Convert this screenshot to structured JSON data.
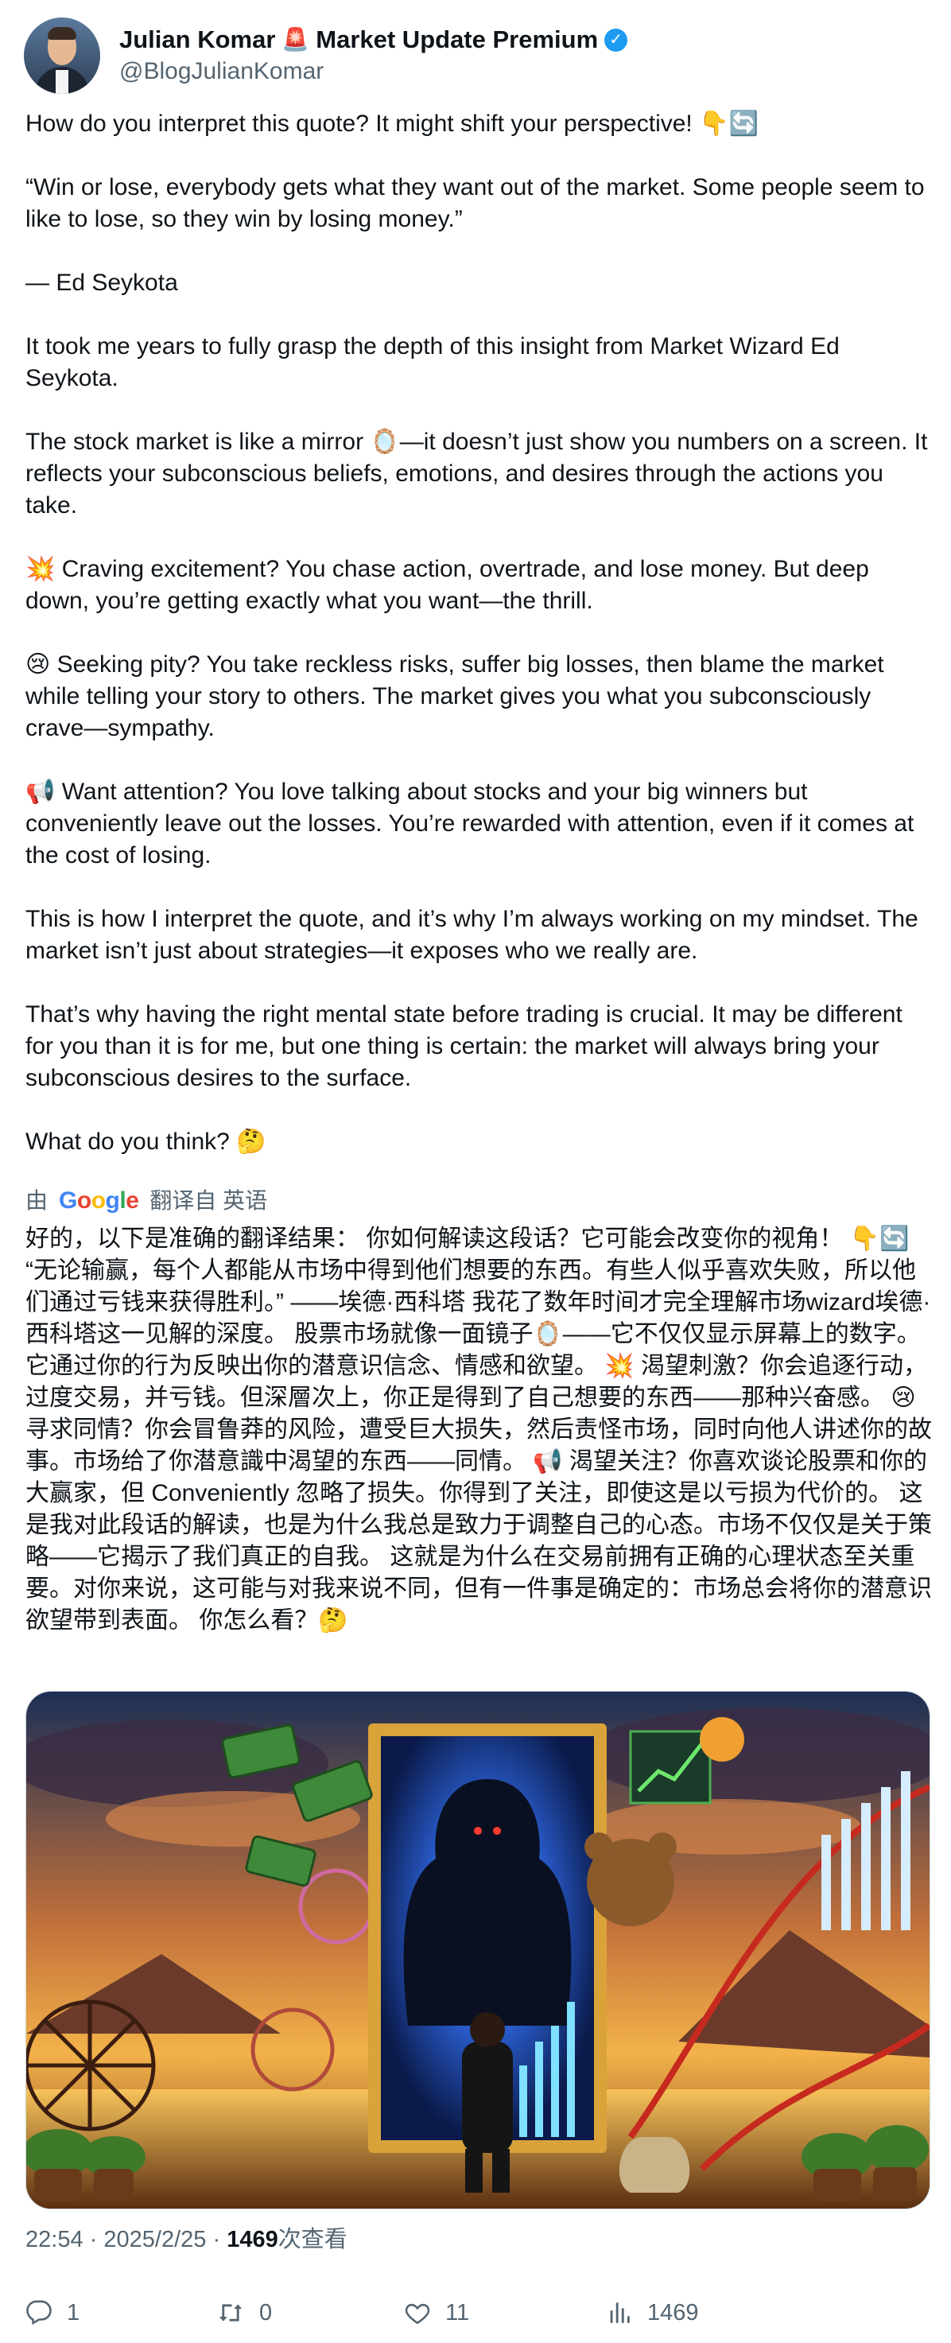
{
  "tweet": {
    "author": {
      "name": "Julian Komar",
      "siren_emoji": "🚨",
      "title_suffix": "Market Update Premium",
      "handle": "@BlogJulianKomar",
      "verified_mark": "✓"
    },
    "paragraphs": [
      "How do you interpret this quote? It might shift your perspective! 👇🔄",
      "“Win or lose, everybody gets what they want out of the market. Some people seem to like to lose, so they win by losing money.”",
      "— Ed Seykota",
      "It took me years to fully grasp the depth of this insight from Market Wizard Ed Seykota.",
      "The stock market is like a mirror 🪞—it doesn’t just show you numbers on a screen. It reflects your subconscious beliefs, emotions, and desires through the actions you take.",
      "💥 Craving excitement? You chase action, overtrade, and lose money. But deep down, you’re getting exactly what you want—the thrill.",
      "😢 Seeking pity? You take reckless risks, suffer big losses, then blame the market while telling your story to others. The market gives you what you subconsciously crave—sympathy.",
      "📢 Want attention? You love talking about stocks and your big winners but conveniently leave out the losses. You’re rewarded with attention, even if it comes at the cost of losing.",
      "This is how I interpret the quote, and it’s why I’m always working on my mindset. The market isn’t just about strategies—it exposes who we really are.",
      "That’s why having the right mental state before trading is crucial. It may be different for you than it is for me, but one thing is certain: the market will always bring your subconscious desires to the surface.",
      "What do you think? 🤔"
    ],
    "translation": {
      "prefix": "由",
      "provider": "Google",
      "suffix": "翻译自 英语",
      "text": "好的，以下是准确的翻译结果： 你如何解读这段话？它可能会改变你的视角！ 👇🔄 “无论输赢，每个人都能从市场中得到他们想要的东西。有些人似乎喜欢失败，所以他们通过亏钱来获得胜利。” ——埃德·西科塔 我花了数年时间才完全理解市场wizard埃德·西科塔这一见解的深度。 股票市场就像一面镜子🪞——它不仅仅显示屏幕上的数字。它通过你的行为反映出你的潜意识信念、情感和欲望。 💥 渴望刺激？你会追逐行动，过度交易，并亏钱。但深層次上，你正是得到了自己想要的东西——那种兴奋感。 😢 寻求同情？你会冒鲁莽的风险，遭受巨大损失，然后责怪市场，同时向他人讲述你的故事。市场给了你潜意識中渴望的东西——同情。 📢 渴望关注？你喜欢谈论股票和你的大赢家，但 Conveniently 忽略了损失。你得到了关注，即使这是以亏损为代价的。 这是我对此段话的解读，也是为什么我总是致力于调整自己的心态。市场不仅仅是关于策略——它揭示了我们真正的自我。 这就是为什么在交易前拥有正确的心理状态至关重要。对你来说，这可能与对我来说不同，但有一件事是确定的：市场总会将你的潜意识欲望带到表面。 你怎么看？🤔"
    },
    "meta": {
      "time": "22:54",
      "separator": "·",
      "date": "2025/2/25",
      "views_count": "1469",
      "views_label": "次查看"
    },
    "actions": {
      "replies": "1",
      "retweets": "0",
      "likes": "11",
      "views": "1469"
    }
  },
  "colors": {
    "text": "#0f1419",
    "secondary": "#536471",
    "verified": "#1d9bf0"
  }
}
